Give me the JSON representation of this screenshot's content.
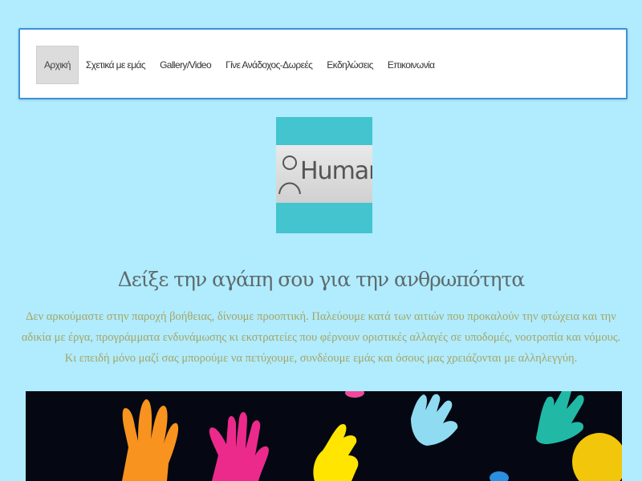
{
  "nav": {
    "items": [
      {
        "label": "Αρχική",
        "active": true
      },
      {
        "label": "Σχετικά με εμάς",
        "active": false
      },
      {
        "label": "Gallery/Video",
        "active": false
      },
      {
        "label": "Γίνε Ανάδοχος-Δωρεές",
        "active": false
      },
      {
        "label": "Εκδηλώσεις",
        "active": false
      },
      {
        "label": "Επικοινωνία",
        "active": false
      }
    ]
  },
  "logo": {
    "text": "Humanity",
    "icon": "person-outline-icon",
    "background_color": "#43c4cf"
  },
  "main": {
    "headline": "Δείξε την αγάπη σου για την ανθρωπότητα",
    "intro": "Δεν αρκούμαστε στην παροχή βοήθειας, δίνουμε προοπτική. Παλεύουμε κατά των αιτιών που προκαλούν την φτώχεια και την αδικία με έργα, προγράμματα ενδυνάμωσης κι εκστρατείες που φέρνουν οριστικές αλλαγές σε υποδομές, νοοτροπία και νόμους. Κι επειδή μόνο μαζί σας μπορούμε να πετύχουμε, συνδέουμε εμάς και όσους μας χρειάζονται με αλληλεγγύη."
  },
  "colors": {
    "page_background": "#b0ecfd",
    "nav_border": "#3d8fe0",
    "headline": "#5e6a6d",
    "intro_text": "#a6a366"
  }
}
